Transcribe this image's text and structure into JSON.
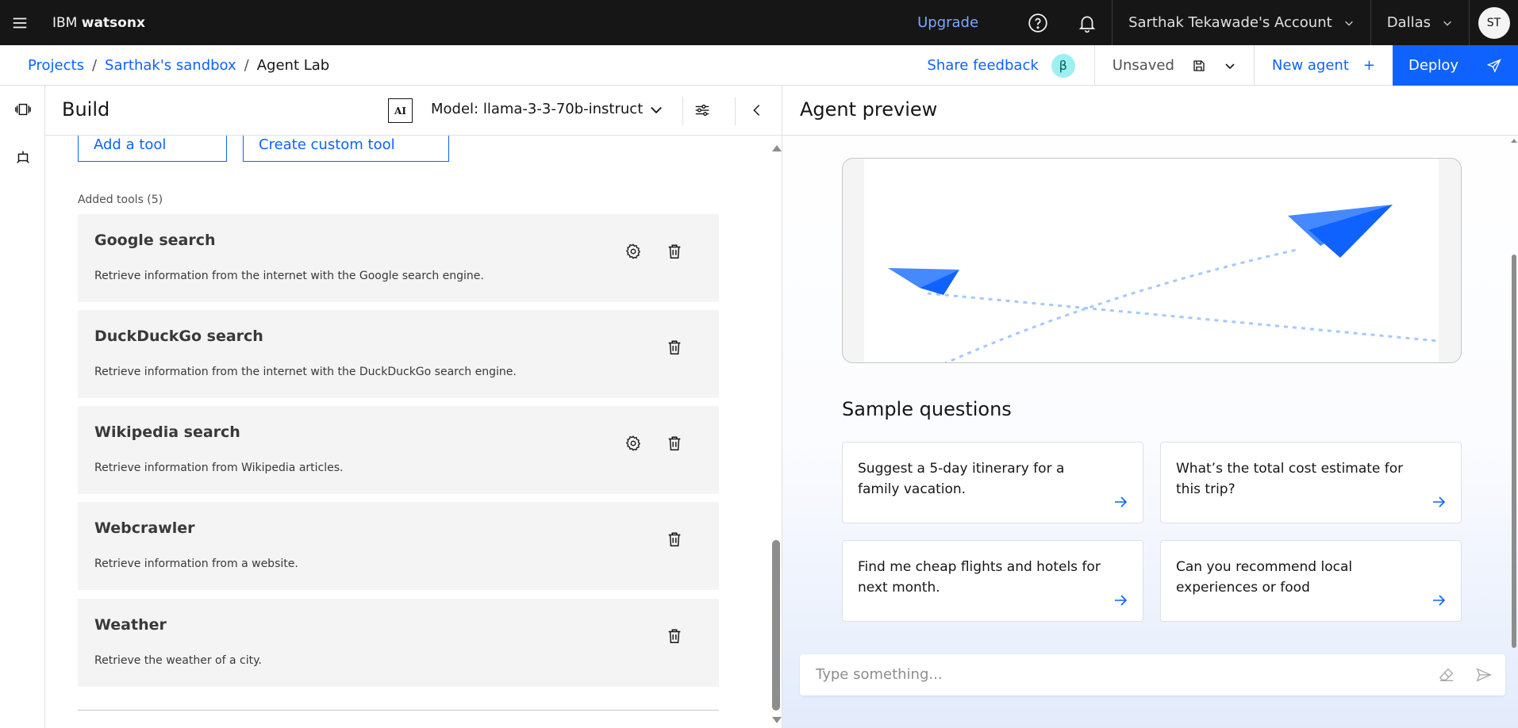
{
  "header": {
    "brand_prefix": "IBM",
    "brand_name": "watsonx",
    "upgrade": "Upgrade",
    "account": "Sarthak Tekawade's Account",
    "region": "Dallas",
    "avatar_initials": "ST"
  },
  "breadcrumb": {
    "items": [
      "Projects",
      "Sarthak's sandbox",
      "Agent Lab"
    ],
    "separator": "/"
  },
  "toolbar": {
    "share_feedback": "Share feedback",
    "beta": "β",
    "unsaved": "Unsaved",
    "new_agent": "New agent",
    "new_agent_plus": "+",
    "deploy": "Deploy"
  },
  "build": {
    "title": "Build",
    "ai_badge": "AI",
    "model": "Model: llama-3-3-70b-instruct",
    "add_tool": "Add a tool",
    "create_custom_tool": "Create custom tool",
    "added_tools_label": "Added tools (5)",
    "tools": [
      {
        "name": "Google search",
        "description": "Retrieve information from the internet with the Google search engine.",
        "has_settings": true
      },
      {
        "name": "DuckDuckGo search",
        "description": "Retrieve information from the internet with the DuckDuckGo search engine.",
        "has_settings": false
      },
      {
        "name": "Wikipedia search",
        "description": "Retrieve information from Wikipedia articles.",
        "has_settings": true
      },
      {
        "name": "Webcrawler",
        "description": "Retrieve information from a website.",
        "has_settings": false
      },
      {
        "name": "Weather",
        "description": "Retrieve the weather of a city.",
        "has_settings": false
      }
    ]
  },
  "preview": {
    "title": "Agent preview",
    "sample_questions_title": "Sample questions",
    "questions": [
      "Suggest a 5-day itinerary for a family vacation.",
      "What’s the total cost estimate for this trip?",
      "Find me cheap flights and hotels for next month.",
      "Can you recommend local experiences or food"
    ],
    "input_placeholder": "Type something..."
  },
  "colors": {
    "primary": "#0f62fe",
    "header_bg": "#161616",
    "card_bg": "#f4f4f4",
    "plane_dark": "#0f62fe",
    "plane_light": "#4589ff",
    "trail": "#a6c8ff"
  },
  "icons": [
    "menu-icon",
    "help-icon",
    "notification-icon",
    "chevron-down-icon",
    "save-icon",
    "send-icon",
    "tune-icon",
    "chevron-left-icon",
    "gear-icon",
    "trash-icon",
    "arrow-right-icon",
    "eraser-icon",
    "agent-icon",
    "carousel-icon"
  ]
}
